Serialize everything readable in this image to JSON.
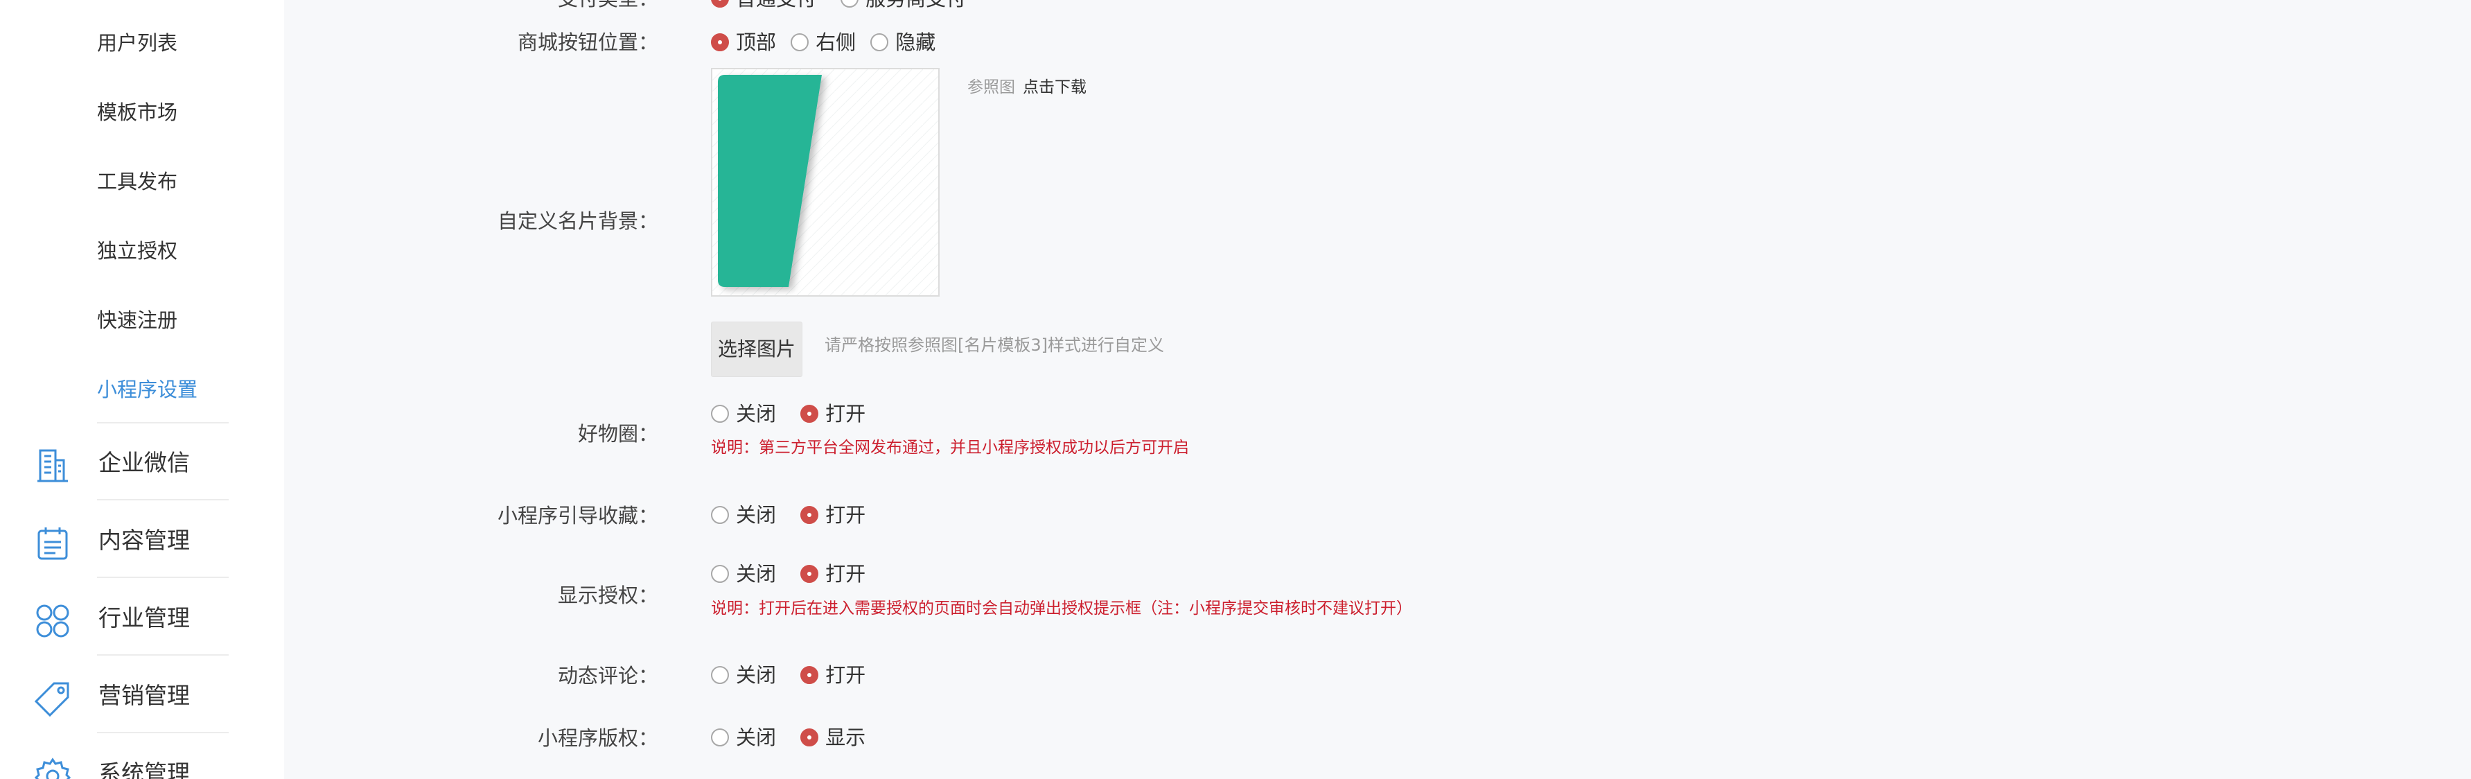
{
  "sidebar": {
    "sub_items": [
      {
        "label": "用户列表"
      },
      {
        "label": "模板市场"
      },
      {
        "label": "工具发布"
      },
      {
        "label": "独立授权"
      },
      {
        "label": "快速注册"
      },
      {
        "label": "小程序设置",
        "active": true
      }
    ],
    "main_items": [
      {
        "label": "企业微信",
        "icon": "building-icon"
      },
      {
        "label": "内容管理",
        "icon": "calendar-list-icon"
      },
      {
        "label": "行业管理",
        "icon": "grid-circles-icon"
      },
      {
        "label": "营销管理",
        "icon": "tag-icon"
      },
      {
        "label": "系统管理",
        "icon": "gear-icon"
      }
    ],
    "accent_color": "#3d8ed9"
  },
  "form": {
    "pay_type": {
      "label": "支付类型：",
      "options": [
        {
          "label": "普通支付",
          "checked": true
        },
        {
          "label": "服务商支付",
          "checked": false
        }
      ]
    },
    "mall_button": {
      "label": "商城按钮位置：",
      "options": [
        {
          "label": "顶部",
          "checked": true
        },
        {
          "label": "右侧",
          "checked": false
        },
        {
          "label": "隐藏",
          "checked": false
        }
      ]
    },
    "card_bg": {
      "label": "自定义名片背景：",
      "ref_label": "参照图",
      "ref_link": "点击下载",
      "select_button": "选择图片",
      "hint": "请严格按照参照图[名片模板3]样式进行自定义",
      "preview_color": "#27b596"
    },
    "goods_circle": {
      "label": "好物圈：",
      "options": [
        {
          "label": "关闭",
          "checked": false
        },
        {
          "label": "打开",
          "checked": true
        }
      ],
      "note": "说明：第三方平台全网发布通过，并且小程序授权成功以后方可开启"
    },
    "guide_favorite": {
      "label": "小程序引导收藏：",
      "options": [
        {
          "label": "关闭",
          "checked": false
        },
        {
          "label": "打开",
          "checked": true
        }
      ]
    },
    "show_auth": {
      "label": "显示授权：",
      "options": [
        {
          "label": "关闭",
          "checked": false
        },
        {
          "label": "打开",
          "checked": true
        }
      ],
      "note": "说明：打开后在进入需要授权的页面时会自动弹出授权提示框（注：小程序提交审核时不建议打开）"
    },
    "dynamic_comment": {
      "label": "动态评论：",
      "options": [
        {
          "label": "关闭",
          "checked": false
        },
        {
          "label": "打开",
          "checked": true
        }
      ]
    },
    "copyright": {
      "label": "小程序版权：",
      "options": [
        {
          "label": "关闭",
          "checked": false
        },
        {
          "label": "显示",
          "checked": true
        }
      ]
    },
    "radio_checked_color": "#cf4d49",
    "note_color": "#cc1f2e"
  }
}
